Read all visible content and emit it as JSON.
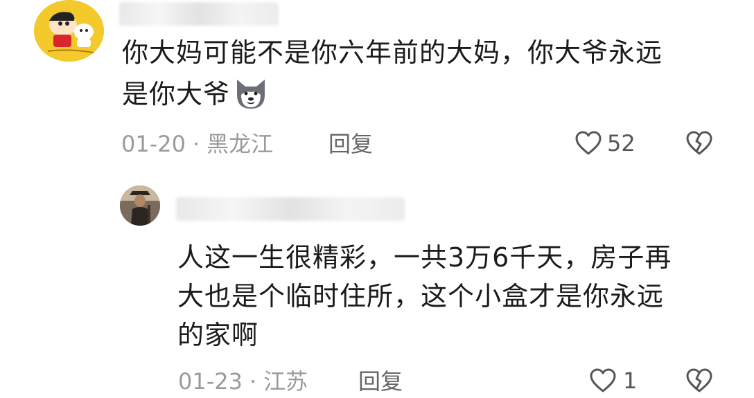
{
  "comments": [
    {
      "text_line1": "你大妈可能不是你六年前的大妈，你大爷永远",
      "text_line2": "是你大爷",
      "emoji": "husky-dog-emoji",
      "date": "01-20",
      "separator": "·",
      "location": "黑龙江",
      "reply_label": "回复",
      "likes": "52"
    },
    {
      "text_line1": "人这一生很精彩，一共3万6千天，房子再",
      "text_line2": "大也是个临时住所，这个小盒才是你永远",
      "text_line3": "的家啊",
      "date": "01-23",
      "separator": "·",
      "location": "江苏",
      "reply_label": "回复",
      "likes": "1"
    }
  ],
  "icons": {
    "like": "heart-outline-icon",
    "dislike": "broken-heart-icon"
  },
  "colors": {
    "text": "#1b1b1b",
    "meta": "#9a9a9a",
    "icon": "#555555",
    "avatar_main_bg": "#f3c92b"
  }
}
